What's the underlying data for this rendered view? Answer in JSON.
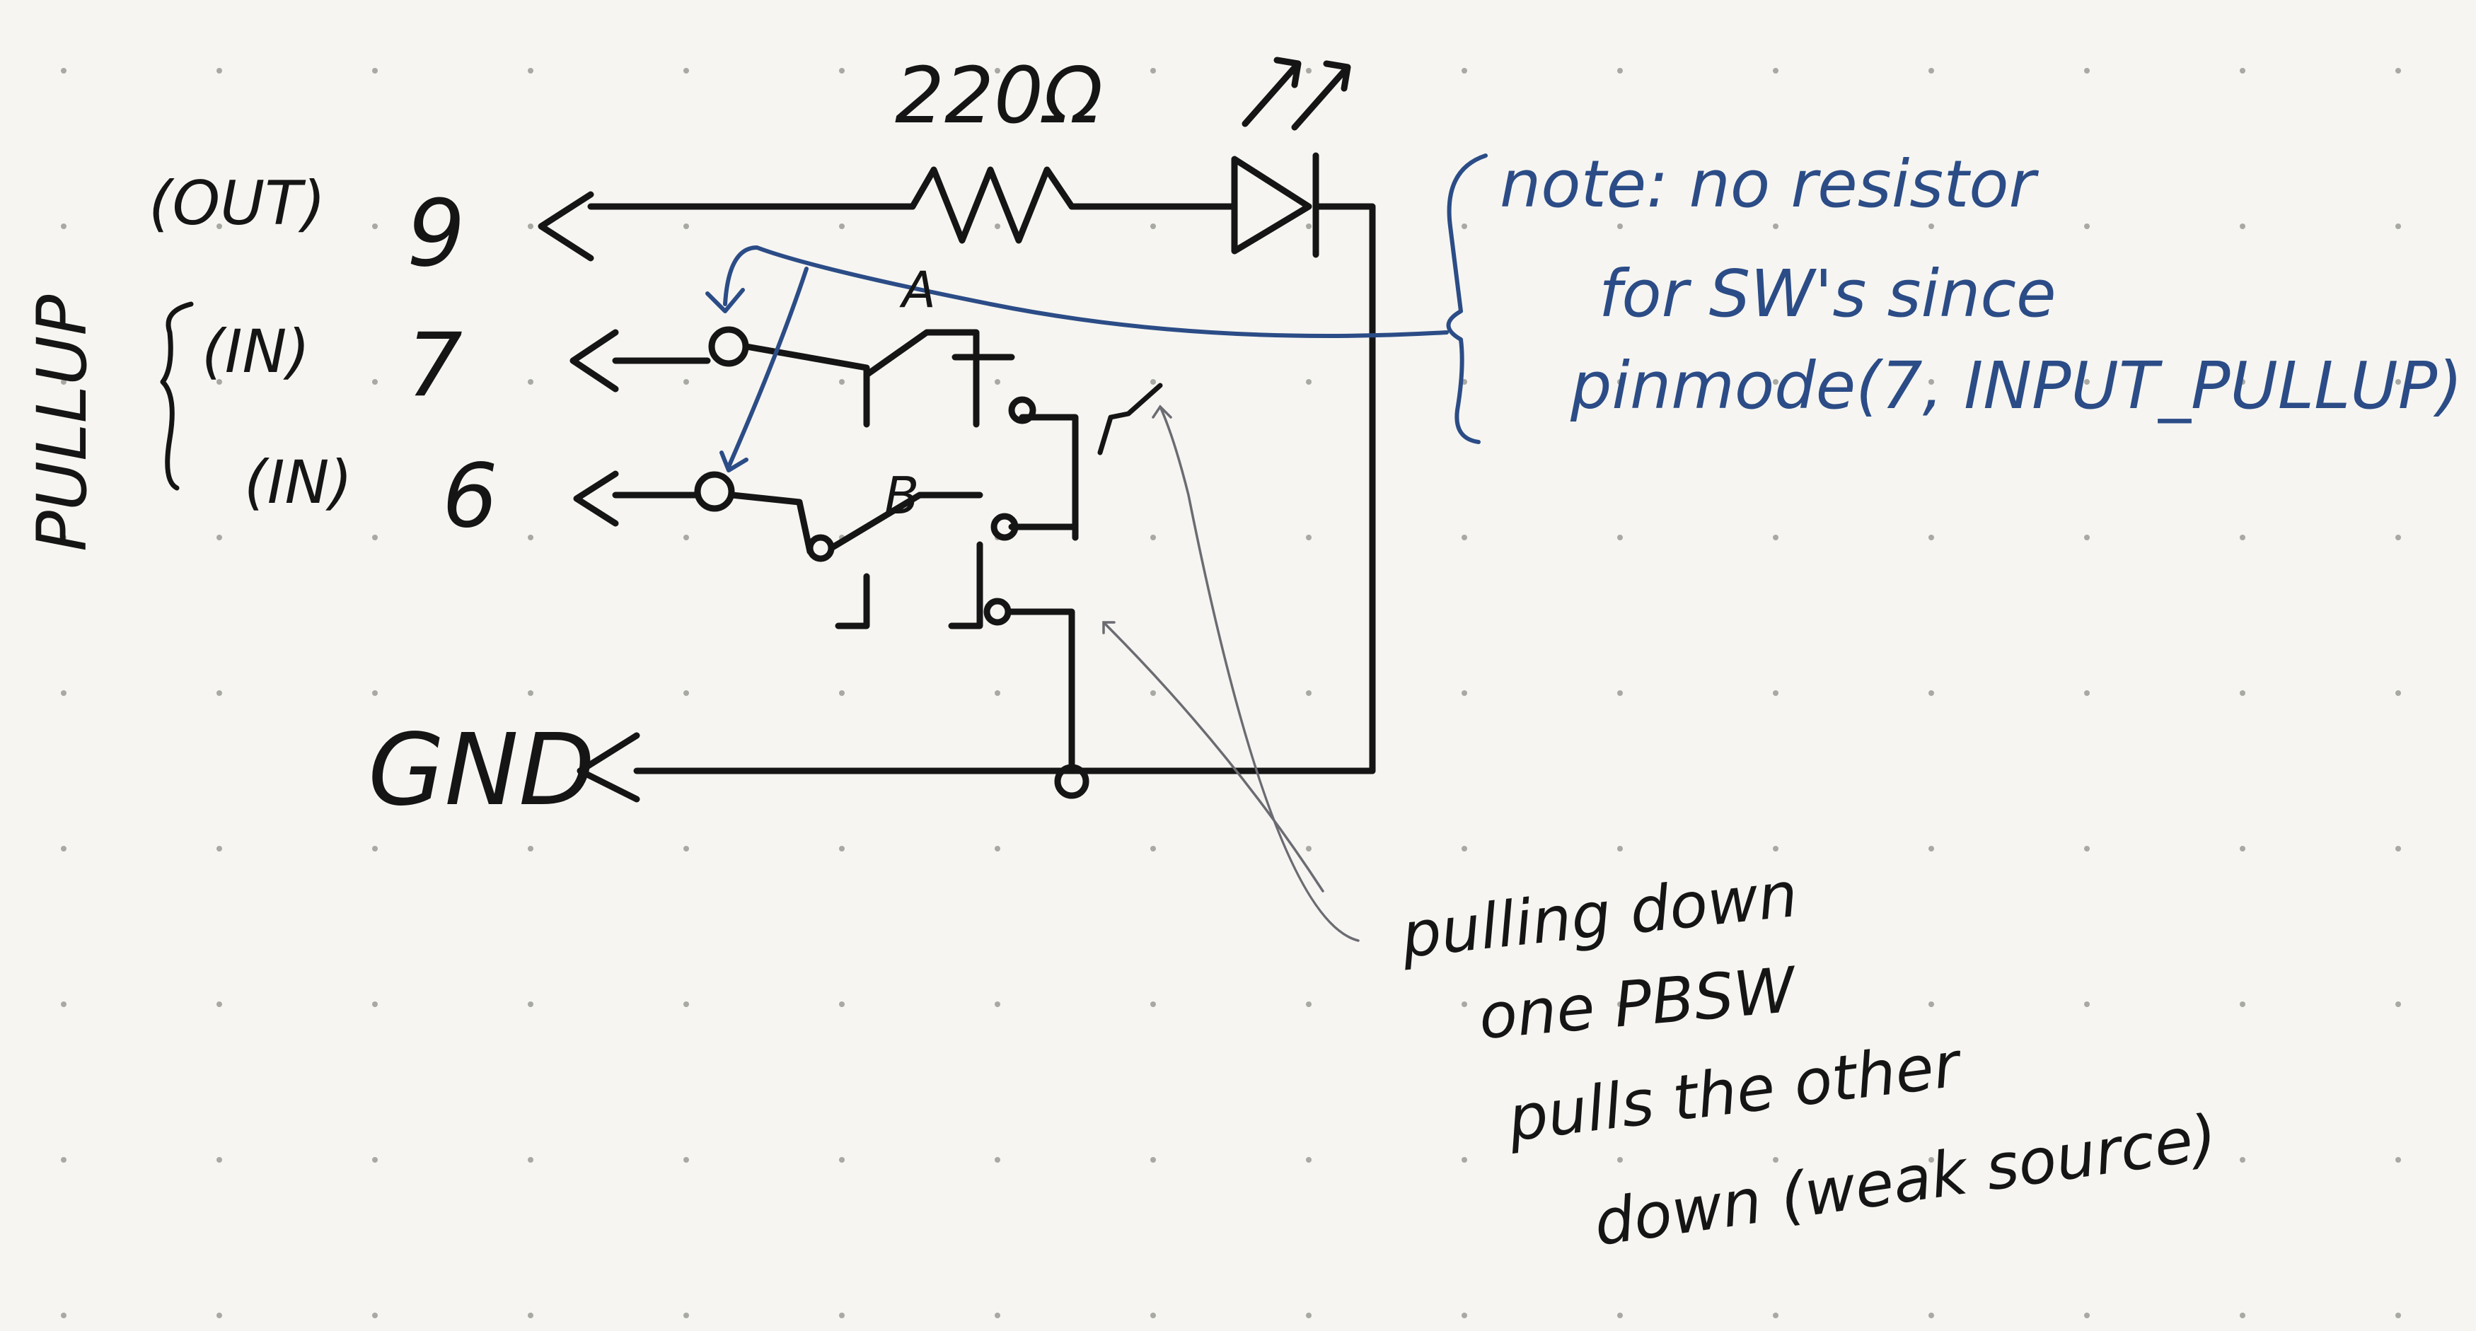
{
  "pins": {
    "out": {
      "mode": "(OUT)",
      "number": "9"
    },
    "in1": {
      "mode": "(IN)",
      "number": "7"
    },
    "in2": {
      "mode": "(IN)",
      "number": "6"
    },
    "gnd": "GND"
  },
  "pullup_label": "PULLUP",
  "resistor_label": "220Ω",
  "switch_labels": {
    "a": "A",
    "b": "B"
  },
  "note_lines": [
    "note: no resistor",
    "for SW's since",
    "pinmode(7, INPUT_PULLUP)"
  ],
  "annotation_lines": [
    "pulling down",
    "one PBSW",
    "pulls the other",
    "down (weak source)"
  ],
  "colors": {
    "ink": "#151515",
    "note_ink": "#2b4c86",
    "paper": "#f6f5f1",
    "pencil": "#6b6b72"
  }
}
